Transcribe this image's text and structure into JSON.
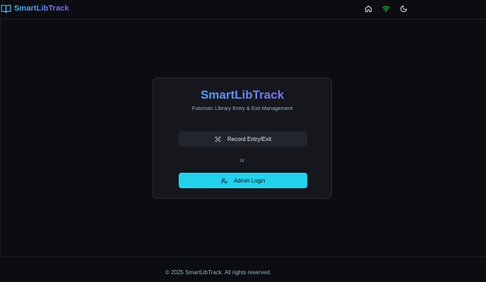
{
  "header": {
    "brand": "SmartLibTrack",
    "nav": [
      {
        "icon": "home-icon"
      },
      {
        "icon": "wifi-icon",
        "color": "#22c55e"
      },
      {
        "icon": "moon-icon"
      }
    ]
  },
  "card": {
    "title": "SmartLibTrack",
    "subtitle": "Futuristic Library Entry & Exit Management",
    "record_button": "Record Entry/Exit",
    "or_label": "or",
    "admin_button": "Admin Login"
  },
  "footer": {
    "text": "© 2025 SmartLibTrack. All rights reserved."
  },
  "colors": {
    "background": "#0c0d11",
    "card": "#16171d",
    "accent": "#22d3ee",
    "gradient_start": "#38bdf8",
    "gradient_end": "#8b5cf6"
  }
}
